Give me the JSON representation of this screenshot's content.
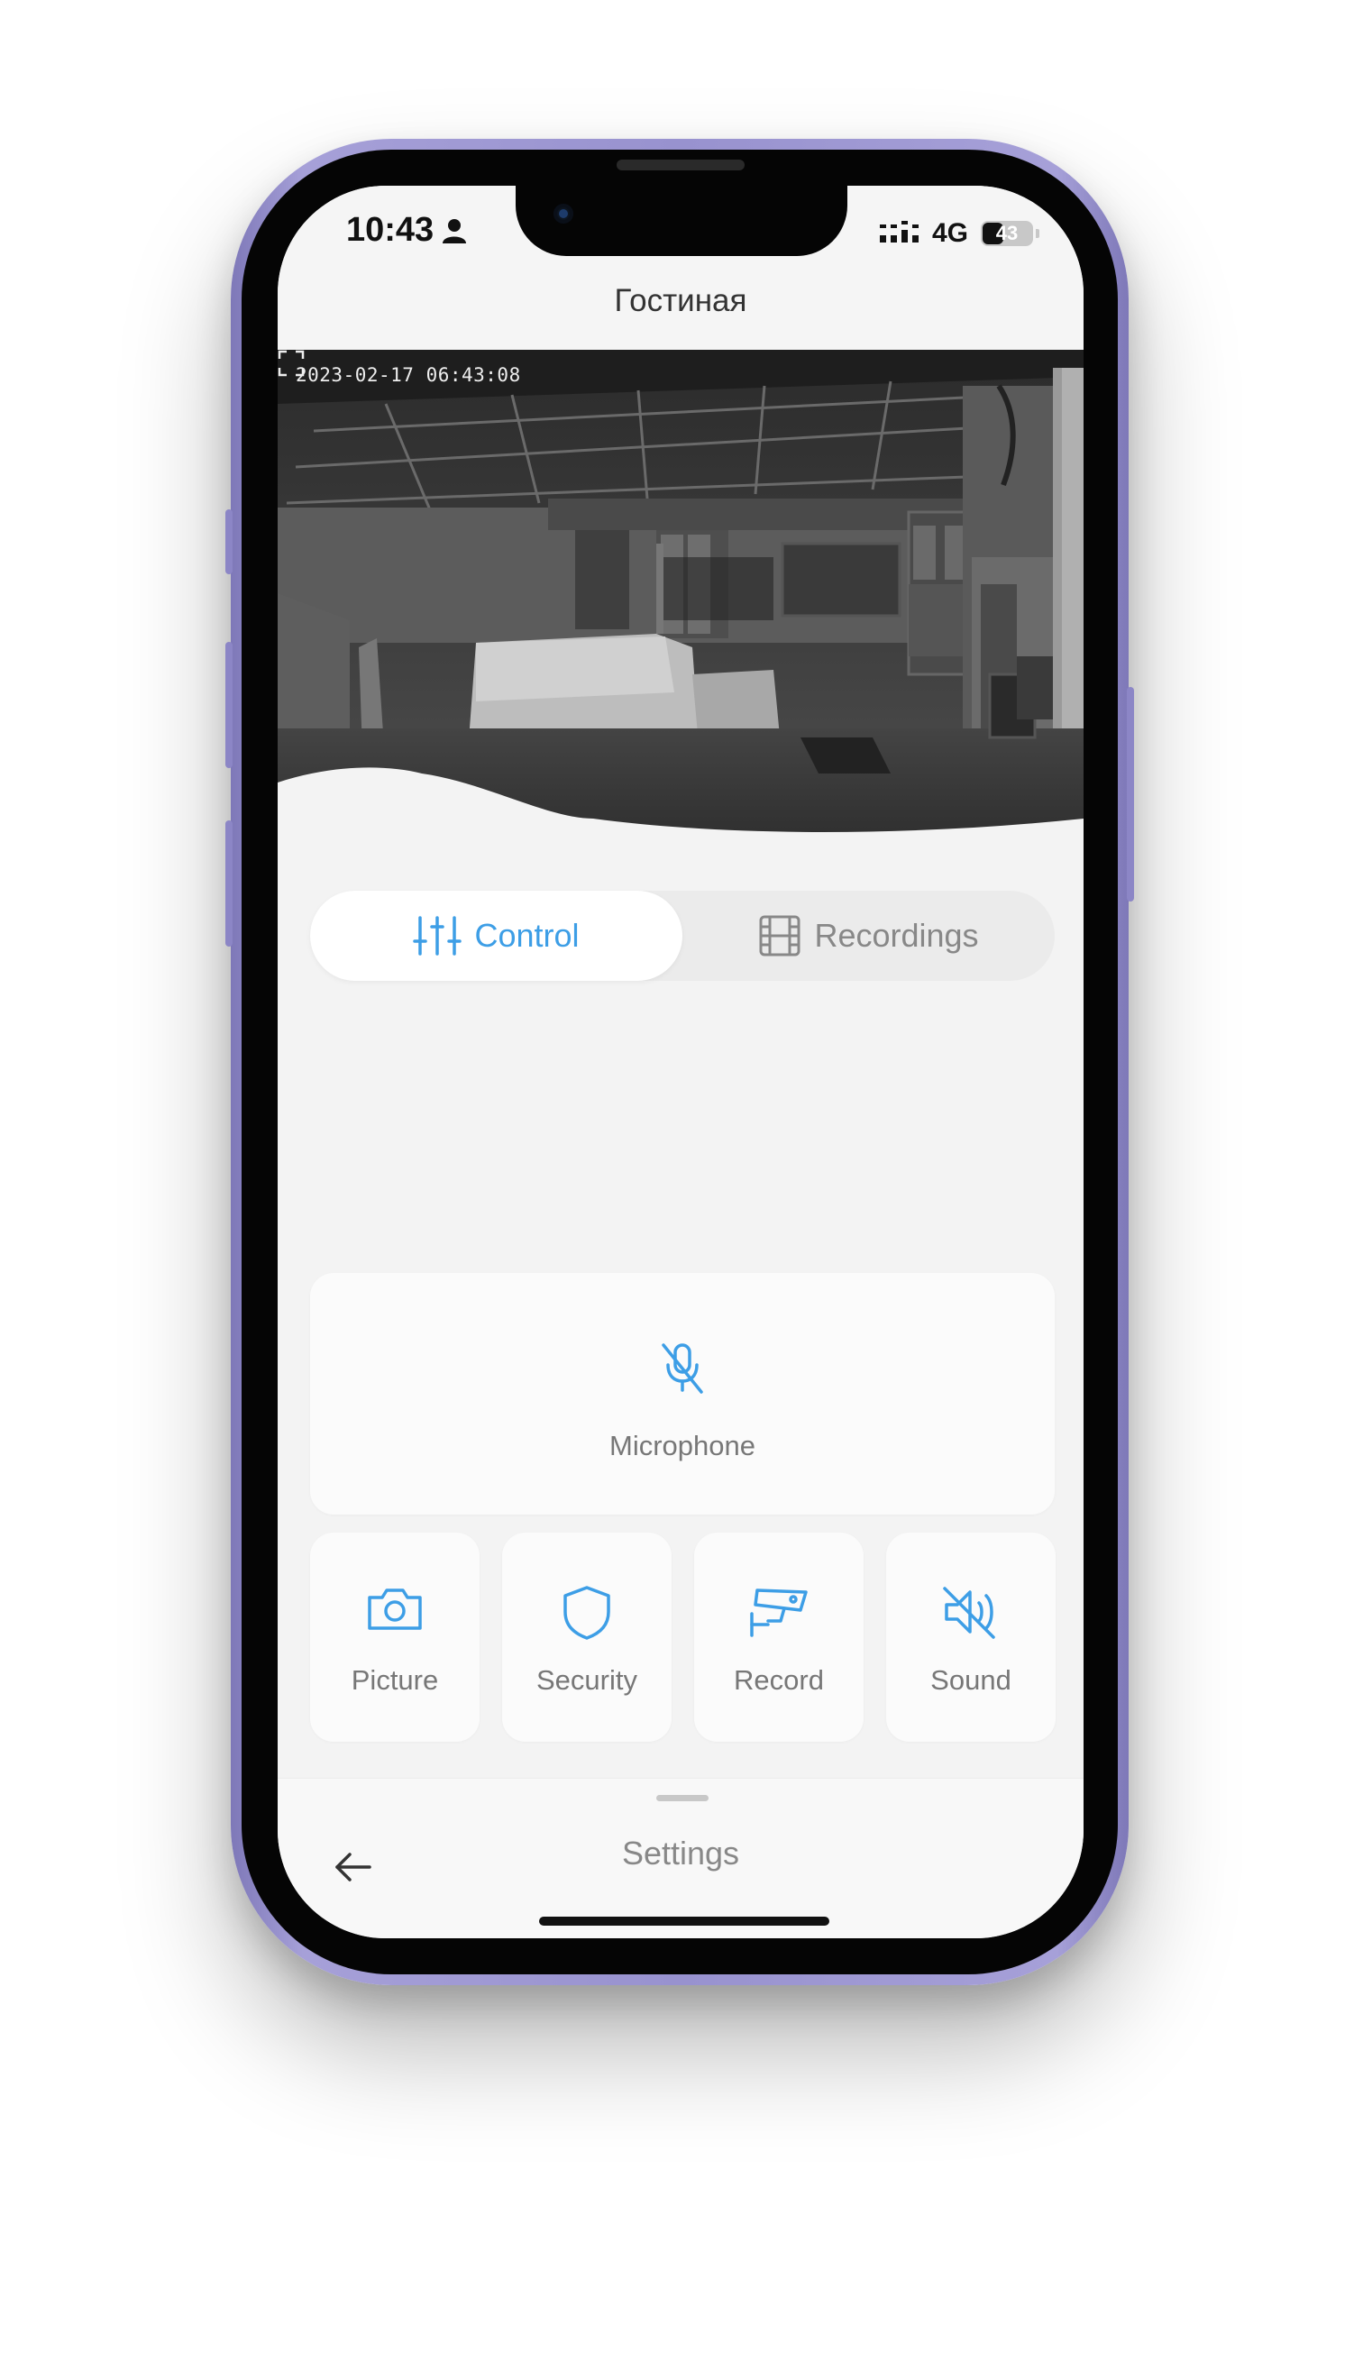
{
  "status_bar": {
    "time": "10:43",
    "network": "4G",
    "battery": "43",
    "battery_level": 0.43
  },
  "header": {
    "title": "Гостиная"
  },
  "camera": {
    "timestamp": "2023-02-17 06:43:08",
    "fullscreen_icon": "fullscreen-icon"
  },
  "tabs": [
    {
      "label": "Control",
      "icon": "sliders-icon",
      "active": true
    },
    {
      "label": "Recordings",
      "icon": "film-icon",
      "active": false
    }
  ],
  "controls": {
    "microphone": {
      "label": "Microphone",
      "icon": "mic-off-icon"
    },
    "tiles": [
      {
        "label": "Picture",
        "icon": "camera-icon"
      },
      {
        "label": "Security",
        "icon": "shield-icon"
      },
      {
        "label": "Record",
        "icon": "cctv-icon"
      },
      {
        "label": "Sound",
        "icon": "speaker-muted-icon"
      }
    ]
  },
  "bottom_sheet": {
    "title": "Settings",
    "back_icon": "arrow-left-icon"
  },
  "colors": {
    "accent": "#3d9ee6",
    "frame": "#9892cf",
    "background": "#f3f3f3"
  }
}
